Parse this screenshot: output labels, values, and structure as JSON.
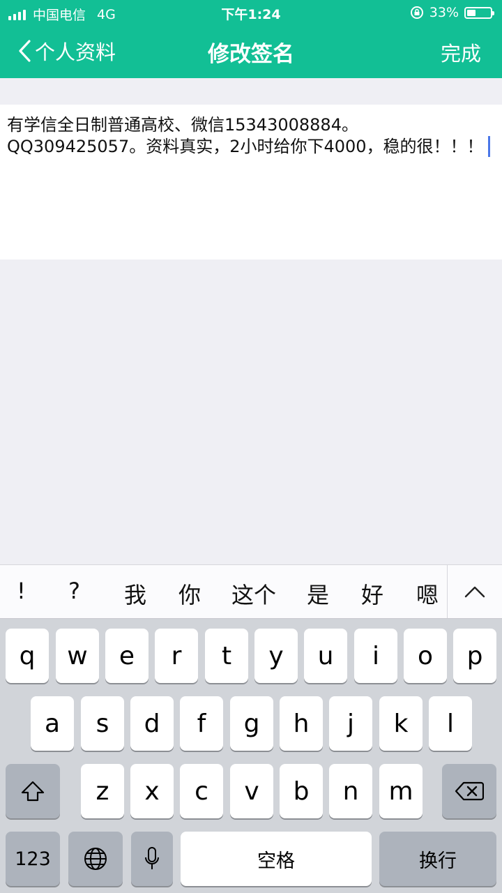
{
  "status_bar": {
    "carrier": "中国电信",
    "network": "4G",
    "time": "下午1:24",
    "battery_percent": "33%",
    "battery_level": 0.33
  },
  "nav": {
    "back_label": "个人资料",
    "title": "修改签名",
    "done_label": "完成"
  },
  "editor": {
    "text": "有学信全日制普通高校、微信15343008884。QQ309425057。资料真实，2小时给你下4000，稳的很！！！"
  },
  "suggestions": [
    "!",
    "?",
    "我",
    "你",
    "这个",
    "是",
    "好",
    "嗯"
  ],
  "keyboard": {
    "row1": [
      "q",
      "w",
      "e",
      "r",
      "t",
      "y",
      "u",
      "i",
      "o",
      "p"
    ],
    "row2": [
      "a",
      "s",
      "d",
      "f",
      "g",
      "h",
      "j",
      "k",
      "l"
    ],
    "row3": [
      "z",
      "x",
      "c",
      "v",
      "b",
      "n",
      "m"
    ],
    "numbers_label": "123",
    "space_label": "空格",
    "return_label": "换行"
  },
  "colors": {
    "accent": "#12bf95",
    "caret": "#4a77e8"
  }
}
